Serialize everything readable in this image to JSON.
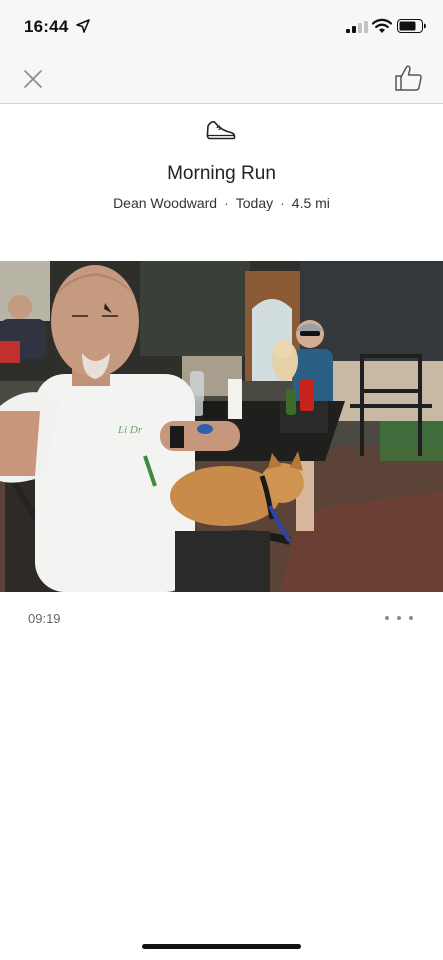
{
  "status_bar": {
    "time": "16:44",
    "icons": [
      "location-arrow-icon",
      "cellular-signal-icon",
      "wifi-icon",
      "battery-icon"
    ]
  },
  "nav": {
    "close_icon": "close-icon",
    "like_icon": "thumbs-up-icon"
  },
  "activity": {
    "type_icon": "running-shoe-icon",
    "title": "Morning Run",
    "athlete": "Dean Woodward",
    "date": "Today",
    "distance": "4.5 mi",
    "separator": "·"
  },
  "photo": {
    "shirt_text": "Li Dr"
  },
  "footer": {
    "duration": "09:19",
    "more_icon": "more-options-icon"
  },
  "colors": {
    "status_bg": "#f7f7f7",
    "divider": "#d6d6d6",
    "text_primary": "#222222",
    "text_secondary": "#666666"
  }
}
